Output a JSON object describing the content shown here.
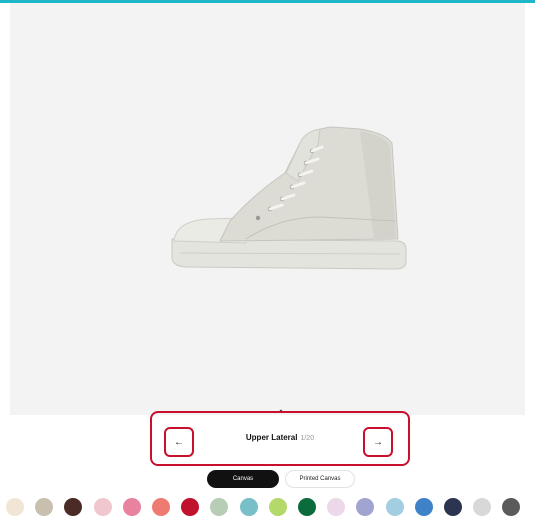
{
  "colors": {
    "accent": "#1fb6c8",
    "stage_bg": "#f3f3f3",
    "highlight": "#c8102e"
  },
  "product": {
    "image_label": "high-top-sneaker-image"
  },
  "view_nav": {
    "collapse_icon": "chevron-up-icon",
    "collapse_glyph": "⌃",
    "prev_icon": "arrow-left-icon",
    "prev_glyph": "←",
    "next_icon": "arrow-right-icon",
    "next_glyph": "→",
    "view_name": "Upper Lateral",
    "view_count": "1/20"
  },
  "material_tabs": [
    {
      "label": "Canvas",
      "selected": true
    },
    {
      "label": "Printed Canvas",
      "selected": false
    }
  ],
  "swatches": [
    "#f1e6d6",
    "#c8bfae",
    "#4a2b26",
    "#f0c7cf",
    "#e9829e",
    "#ee7b72",
    "#c0112d",
    "#b8cdb6",
    "#78bfc7",
    "#b5d86a",
    "#0c6b3c",
    "#ecd8e9",
    "#a1a3d0",
    "#a3cde0",
    "#3e82c7",
    "#2b3550",
    "#d8d8d8",
    "#5b5b5b"
  ]
}
